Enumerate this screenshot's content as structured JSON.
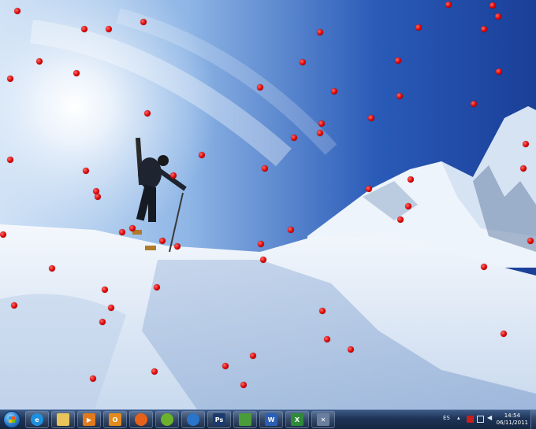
{
  "wallpaper": {
    "description_icon": "snow-mountain-wallpaper",
    "sky_color": "#1f4aa6",
    "snow_color": "#e9f1fb"
  },
  "desktop_dots": {
    "icon": "red-dot-icon",
    "color": "#d90000"
  },
  "taskbar": {
    "start_icon": "windows-start-orb-icon",
    "pinned": [
      {
        "name": "internet-explorer",
        "icon": "internet-explorer-icon",
        "glyph": "e",
        "color": "#1d8fe0"
      },
      {
        "name": "explorer",
        "icon": "folder-icon",
        "glyph": "",
        "color": "#e8c45a"
      },
      {
        "name": "media-player",
        "icon": "media-player-icon",
        "glyph": "▶",
        "color": "#e07a1d"
      },
      {
        "name": "outlook",
        "icon": "outlook-icon",
        "glyph": "O",
        "color": "#e38b1c"
      },
      {
        "name": "firefox",
        "icon": "firefox-icon",
        "glyph": "",
        "color": "#e8611a"
      },
      {
        "name": "spotify",
        "icon": "spotify-icon",
        "glyph": "",
        "color": "#6bb22a"
      },
      {
        "name": "program-blue",
        "icon": "blue-circle-app-icon",
        "glyph": "",
        "color": "#2a74c9"
      },
      {
        "name": "photoshop",
        "icon": "photoshop-icon",
        "glyph": "Ps",
        "color": "#1b3b6e"
      },
      {
        "name": "app-green",
        "icon": "green-document-app-icon",
        "glyph": "",
        "color": "#4a9b3a"
      },
      {
        "name": "word",
        "icon": "word-icon",
        "glyph": "W",
        "color": "#2b5fb4"
      },
      {
        "name": "excel",
        "icon": "excel-icon",
        "glyph": "X",
        "color": "#2f8a3a"
      },
      {
        "name": "snipping",
        "icon": "snipping-tool-icon",
        "glyph": "✕",
        "color": "#6a7f9d"
      }
    ],
    "tray": {
      "language": "ES",
      "icons": [
        "flag-icon",
        "network-icon",
        "volume-icon"
      ],
      "time": "14:54",
      "date": "06/11/2011"
    }
  }
}
